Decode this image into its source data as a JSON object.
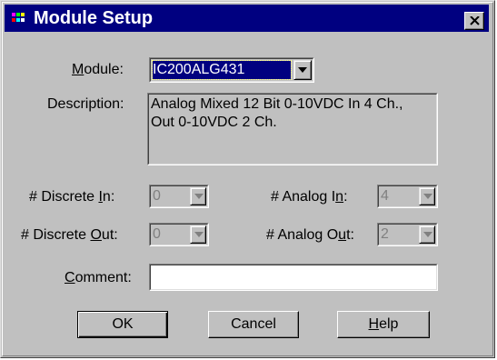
{
  "window": {
    "title": "Module Setup"
  },
  "module": {
    "label": "Module:",
    "value": "IC200ALG431"
  },
  "description": {
    "label": "Description:",
    "line1": "Analog Mixed 12 Bit 0-10VDC In 4 Ch.,",
    "line2": "Out 0-10VDC 2 Ch."
  },
  "discrete_in": {
    "label": "# Discrete In:",
    "value": "0"
  },
  "discrete_out": {
    "label": "# Discrete Out:",
    "value": "0"
  },
  "analog_in": {
    "label": "# Analog In:",
    "value": "4"
  },
  "analog_out": {
    "label": "# Analog Out:",
    "value": "2"
  },
  "comment": {
    "label": "Comment:",
    "value": ""
  },
  "buttons": {
    "ok": "OK",
    "cancel": "Cancel",
    "help": "Help"
  },
  "colors": {
    "titlebar": "#000080",
    "face": "#c0c0c0",
    "selection": "#000080",
    "disabled_text": "#808080"
  }
}
